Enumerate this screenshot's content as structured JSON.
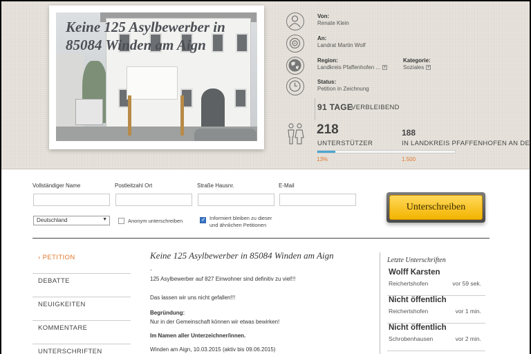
{
  "header": {
    "image_title": "Keine 125 Asylbewerber in 85084 Winden am Aign",
    "from_label": "Von:",
    "from_value": "Renate Klein",
    "to_label": "An:",
    "to_value": "Landrat Martin Wolf",
    "region_label": "Region:",
    "region_value": "Landkreis Pfaffenhofen ...",
    "category_label": "Kategorie:",
    "category_value": "Soziales",
    "status_label": "Status:",
    "status_value": "Petition in Zeichnung",
    "days_count": "91 TAGE",
    "days_text": "VERBLEIBEND",
    "supporters_count": "218",
    "supporters_label": "UNTERSTÜTZER",
    "region_supporters_count": "188",
    "region_supporters_label": "IN LANDKREIS PFAFFENHOFEN AN DER ILM",
    "progress_fraction": 0.13,
    "progress_percent": "13%",
    "goal": "1.500",
    "icons": [
      "person-icon",
      "target-icon",
      "globe-icon",
      "clock-icon",
      "people-icon"
    ]
  },
  "form": {
    "name_label": "Vollständiger Name",
    "zip_label": "Postleitzahl Ort",
    "street_label": "Straße Hausnr.",
    "email_label": "E-Mail",
    "country_value": "Deutschland",
    "anonymous_label": "Anonym unterschreiben",
    "anonymous_checked": false,
    "inform_label_1": "Informiert bleiben zu dieser",
    "inform_label_2": "und ähnlichen Petitionen",
    "inform_checked": true,
    "submit_label": "Unterschreiben",
    "submit_color": "#f3b400"
  },
  "nav": {
    "items": [
      "› PETITION",
      "DEBATTE",
      "NEUIGKEITEN",
      "KOMMENTARE",
      "UNTERSCHRIFTEN"
    ],
    "active_color": "#e0762e"
  },
  "content": {
    "title": "Keine 125 Asylbewerber in 85084 Winden am Aign",
    "dash": "-",
    "line1": "125 Asylbewerber auf 827 Einwohner sind definitiv zu viel!!!",
    "line2": "Das lassen wir uns nicht gefallen!!!",
    "reason_label": "Begründung:",
    "reason_text": "Nur in der Gemeinschaft können wir etwas bewirken!",
    "signers_label": "Im Namen aller Unterzeichner/innen.",
    "place_date": "Winden am Aign, 10.03.2015 (aktiv bis 09.06.2015)"
  },
  "sidebar": {
    "title": "Letzte Unterschriften",
    "signatures": [
      {
        "name": "Wolff Karsten",
        "place": "Reichertshofen",
        "time": "vor 59 sek."
      },
      {
        "name": "Nicht öffentlich",
        "place": "Reichertshofen",
        "time": "vor 1 min."
      },
      {
        "name": "Nicht öffentlich",
        "place": "Schrobenhausen",
        "time": "vor 2 min."
      }
    ]
  }
}
